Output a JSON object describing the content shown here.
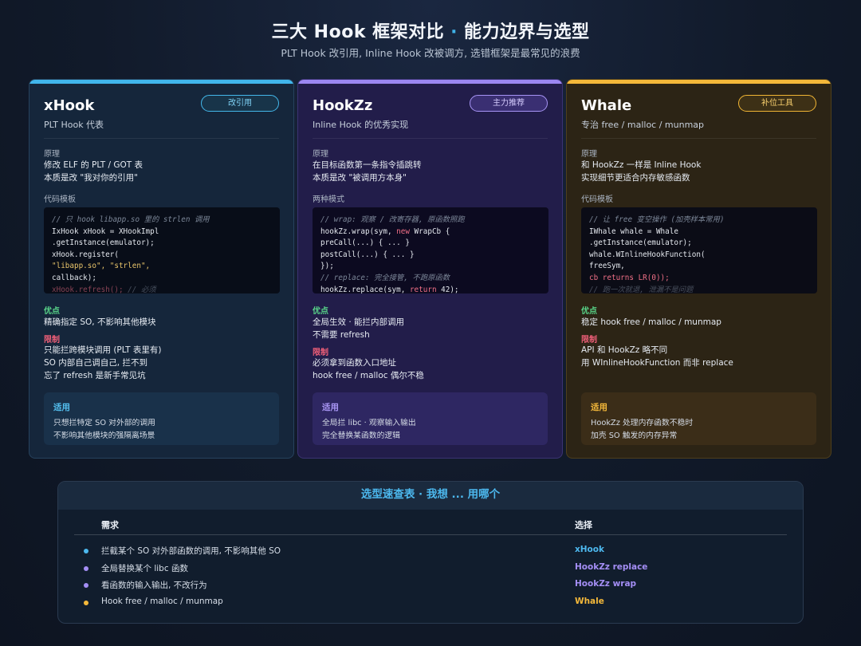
{
  "header": {
    "title_main": "三大 Hook 框架对比",
    "title_dot": "·",
    "title_tail": "能力边界与选型",
    "subtitle": "PLT Hook 改引用, Inline Hook 改被调方, 选错框架是最常见的浪费"
  },
  "cards": [
    {
      "name": "xHook",
      "tagline": "PLT Hook 代表",
      "badge": "改引用",
      "principle_label": "原理",
      "principle": "修改 ELF 的 PLT / GOT 表\n本质是改 \"我对你的引用\"",
      "code_label": "代码模板",
      "pros_label": "优点",
      "pros": "精确指定 SO, 不影响其他模块",
      "cons_label": "限制",
      "cons": "只能拦跨模块调用 (PLT 表里有)\nSO 内部自己调自己, 拦不到\n忘了 refresh 是新手常见坑",
      "fit_label": "适用",
      "fit": "只想拦特定 SO 对外部的调用\n不影响其他模块的强隔离场景"
    },
    {
      "name": "HookZz",
      "tagline": "Inline Hook 的优秀实现",
      "badge": "主力推荐",
      "principle_label": "原理",
      "principle": "在目标函数第一条指令插跳转\n本质是改 \"被调用方本身\"",
      "code_label": "两种模式",
      "pros_label": "优点",
      "pros": "全局生效 · 能拦内部调用\n不需要 refresh",
      "cons_label": "限制",
      "cons": "必须拿到函数入口地址\nhook free / malloc 偶尔不稳",
      "fit_label": "适用",
      "fit": "全局拦 libc · 观察输入输出\n完全替换某函数的逻辑"
    },
    {
      "name": "Whale",
      "tagline": "专治 free / malloc / munmap",
      "badge": "补位工具",
      "principle_label": "原理",
      "principle": "和 HookZz 一样是 Inline Hook\n实现细节更适合内存敏感函数",
      "code_label": "代码模板",
      "pros_label": "优点",
      "pros": "稳定 hook free / malloc / munmap",
      "cons_label": "限制",
      "cons": "API 和 HookZz 略不同\n用 WInlineHookFunction 而非 replace",
      "fit_label": "适用",
      "fit": "HookZz 处理内存函数不稳时\n加壳 SO 触发的内存异常"
    }
  ],
  "code": {
    "xhook": {
      "l1": "// 只 hook libapp.so 里的 strlen 调用",
      "l2": "IxHook xHook = XHookImpl",
      "l3": ".getInstance(emulator);",
      "l4": "xHook.register(",
      "l5": "\"libapp.so\", \"strlen\",",
      "l6": "callback);",
      "l7": "xHook.refresh();",
      "l7c": " // 必须"
    },
    "hookzz": {
      "l1": "// wrap: 观察 / 改寄存器, 原函数照跑",
      "l2a": "hookZz.wrap(sym, ",
      "l2k": "new",
      "l2b": " WrapCb {",
      "l3": "preCall(...) { ... }",
      "l4": "postCall(...) { ... }",
      "l5": "});",
      "l6": "// replace: 完全接管, 不跑原函数",
      "l7a": "hookZz.replace(sym, ",
      "l7k": "return",
      "l7b": " 42);"
    },
    "whale": {
      "l1": "// 让 free 变空操作 (加壳样本常用)",
      "l2": "IWhale whale = Whale",
      "l3": ".getInstance(emulator);",
      "l4": "whale.WInlineHookFunction(",
      "l5": "freeSym,",
      "l6": "cb returns LR(0));",
      "l7": "// 跑一次就退, 泄漏不是问题"
    }
  },
  "quick_table": {
    "title": "选型速查表 · 我想 ... 用哪个",
    "col_need": "需求",
    "col_choice": "选择",
    "rows": [
      {
        "need": "拦截某个 SO 对外部函数的调用, 不影响其他 SO",
        "choice": "xHook",
        "color": "#4db8ee"
      },
      {
        "need": "全局替换某个 libc 函数",
        "choice": "HookZz replace",
        "color": "#a48ef5"
      },
      {
        "need": "看函数的输入输出, 不改行为",
        "choice": "HookZz wrap",
        "color": "#a48ef5"
      },
      {
        "need": "Hook free / malloc / munmap",
        "choice": "Whale",
        "color": "#f4b83a"
      }
    ]
  },
  "colors": {
    "xhook_accent": "#41b6ec",
    "hookzz_accent": "#9c86f2",
    "whale_accent": "#f4b83a",
    "pros": "#59d68a",
    "cons": "#ef5f78"
  }
}
